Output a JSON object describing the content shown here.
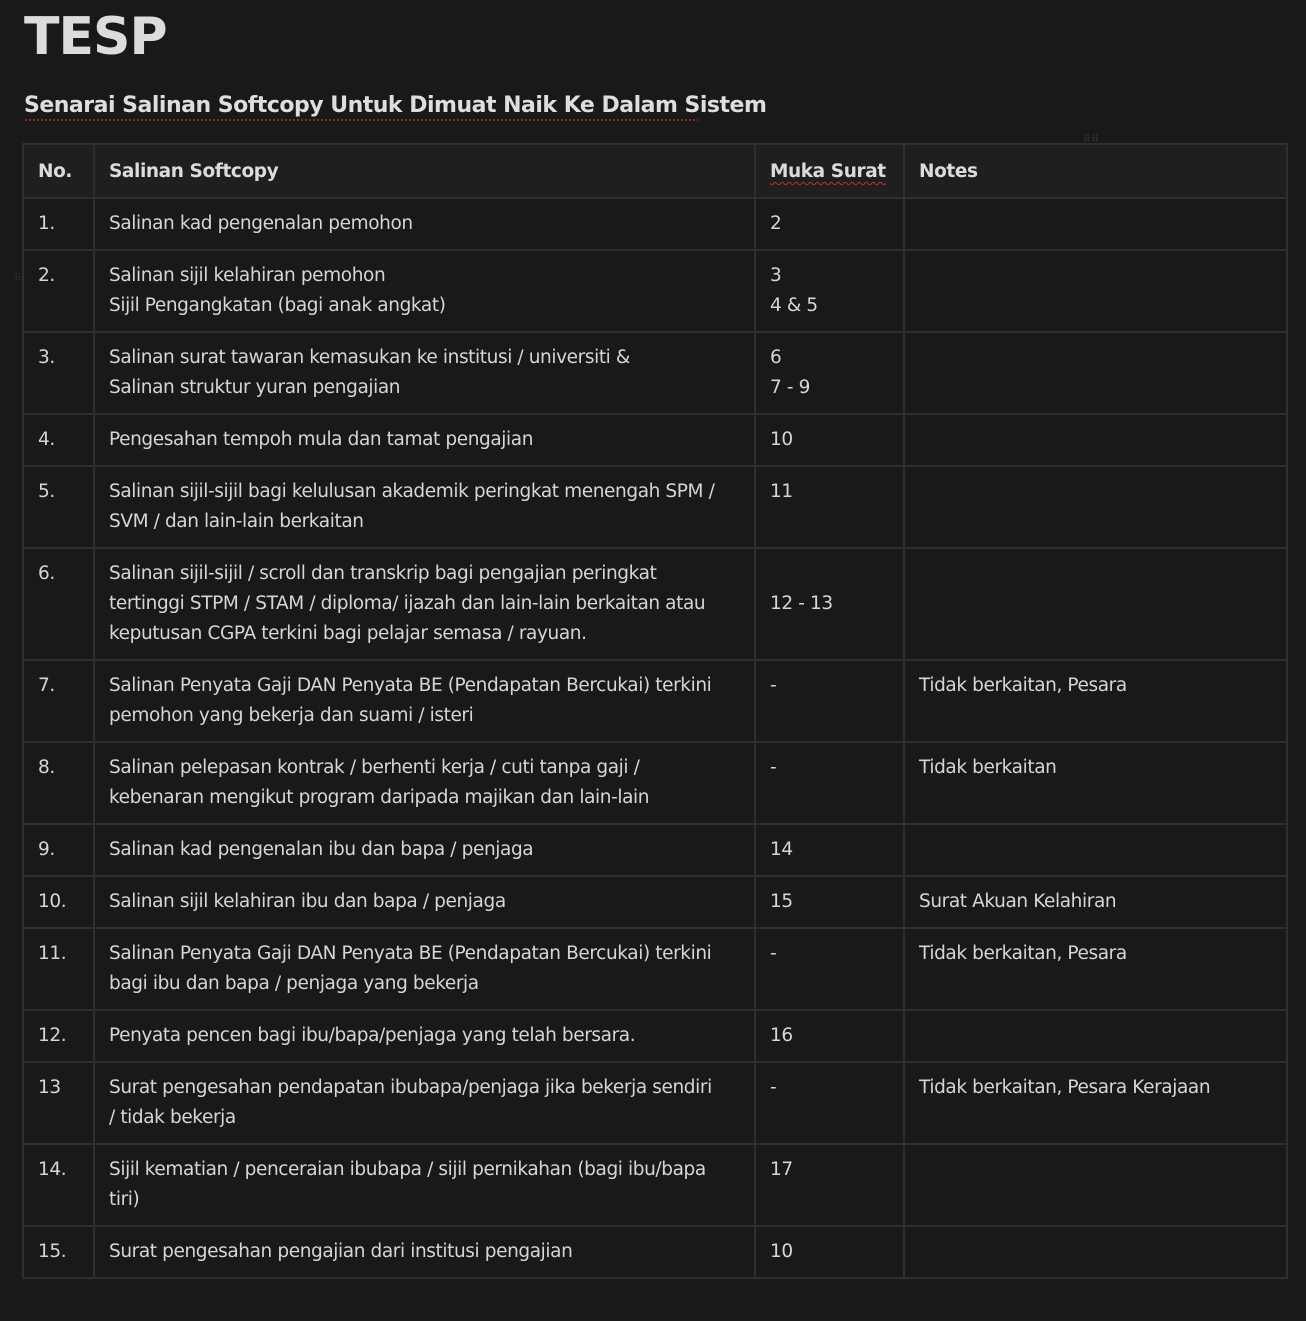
{
  "title": "TESP",
  "section_heading": "Senarai Salinan Softcopy Untuk Dimuat Naik Ke Dalam Sistem",
  "table": {
    "headers": {
      "no": "No.",
      "item": "Salinan Softcopy",
      "page": "Muka Surat",
      "notes": "Notes"
    },
    "rows": [
      {
        "no": "1.",
        "item": "Salinan kad pengenalan pemohon",
        "page": "2",
        "notes": ""
      },
      {
        "no": "2.",
        "item": "Salinan sijil kelahiran pemohon\nSijil Pengangkatan (bagi anak angkat)",
        "page": "3\n4 & 5",
        "notes": ""
      },
      {
        "no": "3.",
        "item": "Salinan surat tawaran kemasukan ke institusi / universiti &\nSalinan struktur yuran pengajian",
        "page": "6\n7 - 9",
        "notes": ""
      },
      {
        "no": "4.",
        "item": "Pengesahan tempoh mula dan tamat pengajian",
        "page": "10",
        "notes": ""
      },
      {
        "no": "5.",
        "item": "Salinan sijil-sijil bagi kelulusan akademik peringkat menengah SPM /\nSVM / dan lain-lain berkaitan",
        "page": "11",
        "notes": ""
      },
      {
        "no": "6.",
        "item": "Salinan sijil-sijil / scroll dan transkrip bagi pengajian peringkat\ntertinggi STPM / STAM / diploma/ ijazah dan lain-lain berkaitan atau\nkeputusan CGPA terkini bagi pelajar semasa / rayuan.",
        "page": "12 - 13",
        "notes": ""
      },
      {
        "no": "7.",
        "item": "Salinan Penyata Gaji DAN Penyata BE (Pendapatan Bercukai) terkini\npemohon yang bekerja dan suami / isteri",
        "page": "-",
        "notes": "Tidak berkaitan, Pesara"
      },
      {
        "no": "8.",
        "item": "Salinan pelepasan kontrak / berhenti kerja / cuti tanpa gaji /\nkebenaran mengikut program daripada majikan dan lain-lain",
        "page": "-",
        "notes": "Tidak berkaitan"
      },
      {
        "no": "9.",
        "item": "Salinan kad pengenalan ibu dan bapa / penjaga",
        "page": "14",
        "notes": ""
      },
      {
        "no": "10.",
        "item": "Salinan sijil kelahiran ibu dan bapa / penjaga",
        "page": "15",
        "notes": "Surat Akuan Kelahiran"
      },
      {
        "no": "11.",
        "item": "Salinan Penyata Gaji DAN Penyata BE (Pendapatan Bercukai) terkini\nbagi ibu dan bapa / penjaga yang bekerja",
        "page": "-",
        "notes": "Tidak berkaitan, Pesara"
      },
      {
        "no": "12.",
        "item": "Penyata pencen bagi ibu/bapa/penjaga yang telah bersara.",
        "page": "16",
        "notes": ""
      },
      {
        "no": "13",
        "item": "Surat pengesahan pendapatan ibubapa/penjaga jika bekerja sendiri\n/ tidak bekerja",
        "page": "-",
        "notes": "Tidak berkaitan, Pesara Kerajaan"
      },
      {
        "no": "14.",
        "item": "Sijil kematian / penceraian ibubapa / sijil pernikahan (bagi ibu/bapa\ntiri)",
        "page": "17",
        "notes": ""
      },
      {
        "no": "15.",
        "item": "Surat pengesahan pengajian dari institusi pengajian",
        "page": "10",
        "notes": ""
      }
    ]
  },
  "icons": {
    "table_handle": "drag-handle-icon",
    "block_handle": "drag-handle-icon"
  },
  "colors": {
    "background": "#191919",
    "text": "#d4d4d4",
    "border": "#2f2f2f",
    "spellcheck": "#c0302a"
  }
}
